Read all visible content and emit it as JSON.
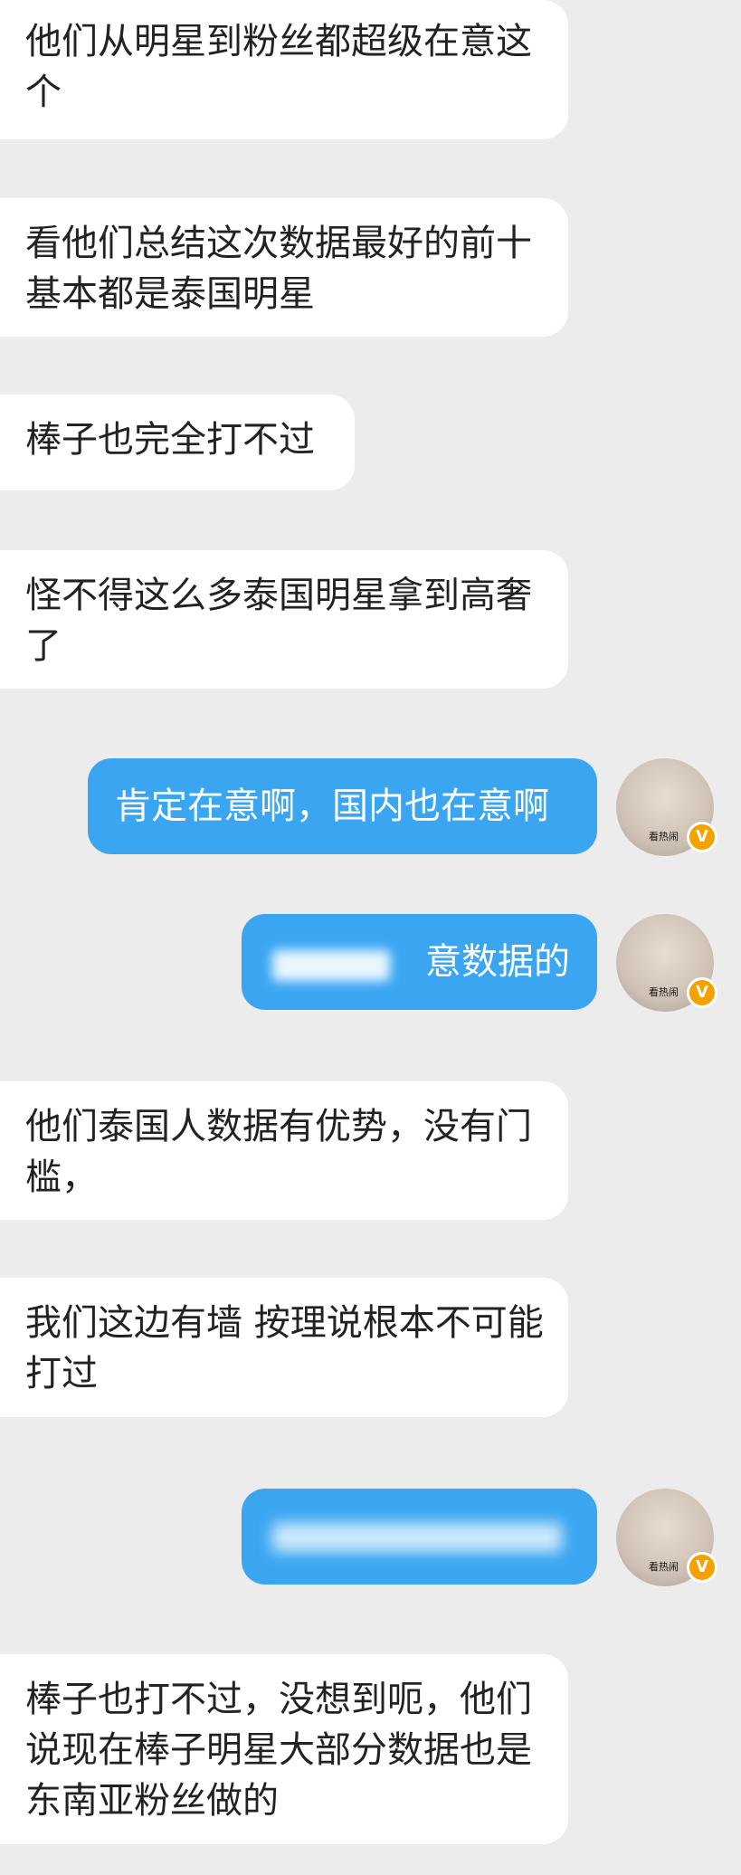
{
  "messages": [
    {
      "side": "in",
      "text": "他们从明星到粉丝都超级在意这个"
    },
    {
      "side": "in",
      "text": "看他们总结这次数据最好的前十基本都是泰国明星"
    },
    {
      "side": "in",
      "text": "棒子也完全打不过"
    },
    {
      "side": "in",
      "text": "怪不得这么多泰国明星拿到高奢了"
    },
    {
      "side": "out",
      "text": "肯定在意啊，国内也在意啊"
    },
    {
      "side": "out",
      "text": "意数据的",
      "partially_redacted": true
    },
    {
      "side": "in",
      "text": "他们泰国人数据有优势，没有门槛，"
    },
    {
      "side": "in",
      "text": "我们这边有墙 按理说根本不可能打过"
    },
    {
      "side": "out",
      "text": "",
      "redacted": true
    },
    {
      "side": "in",
      "text": "棒子也打不过，没想到呃，他们说现在棒子明星大部分数据也是东南亚粉丝做的"
    }
  ],
  "avatar": {
    "caption": "看热闹",
    "badge": "V"
  },
  "colors": {
    "background": "#ececec",
    "incoming": "#ffffff",
    "outgoing": "#3aa6f2",
    "badge": "#f5a100"
  }
}
